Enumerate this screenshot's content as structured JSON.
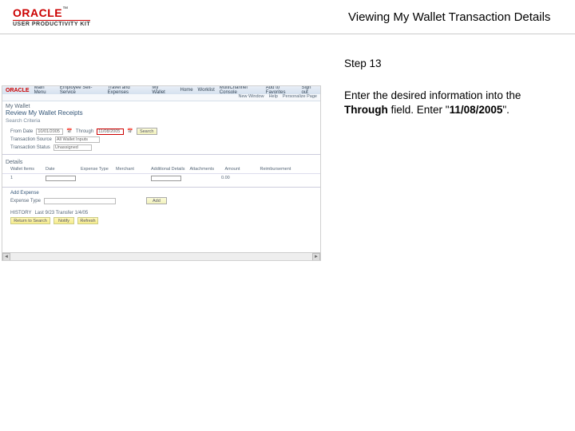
{
  "header": {
    "brand": "ORACLE",
    "trademark": "™",
    "product": "USER PRODUCTIVITY KIT",
    "title": "Viewing My Wallet Transaction Details"
  },
  "instructions": {
    "step": "Step 13",
    "line1": "Enter the desired information into the ",
    "bold1": "Through",
    "line2": " field. Enter \"",
    "bold2": "11/08/2005",
    "line3": "\"."
  },
  "ss": {
    "brand": "ORACLE",
    "menubar": [
      "Main Menu",
      "Employee Self-Service",
      "Travel and Expenses",
      "My Wallet"
    ],
    "navlinks": [
      "Home",
      "Worklist",
      "MultiChannel Console",
      "Add to Favorites",
      "Sign out"
    ],
    "submenu": [
      "New Window",
      "Help",
      "Personalize Page"
    ],
    "crumb": "My Wallet",
    "page_title": "Review My Wallet Receipts",
    "subtitle": "Search Criteria",
    "from_label": "From Date",
    "from_value": "10/01/2005",
    "through_label": "Through",
    "through_value": "11/08/2005",
    "search_btn": "Search",
    "src_label": "Transaction Source",
    "src_value": "All Wallet Inputs",
    "status_label": "Transaction Status",
    "status_value": "Unassigned",
    "details_label": "Details",
    "cols": [
      "Wallet Items",
      "Date",
      "Expense Type",
      "Merchant",
      "Additional Details",
      "Attachments",
      "Amount",
      "Reimbursement"
    ],
    "row_idx": "1",
    "row_amt": "0.00",
    "add_expense": "Add Expense",
    "expense_type_label": "Expense Type",
    "add_btn": "Add",
    "history_label": "HISTORY",
    "history_val": "Last 9/23 Transfer 1/4/05",
    "bottombtn1": "Return to Search",
    "bottombtn2": "Notify",
    "bottombtn3": "Refresh",
    "scroll_left": "◄",
    "scroll_right": "►"
  }
}
